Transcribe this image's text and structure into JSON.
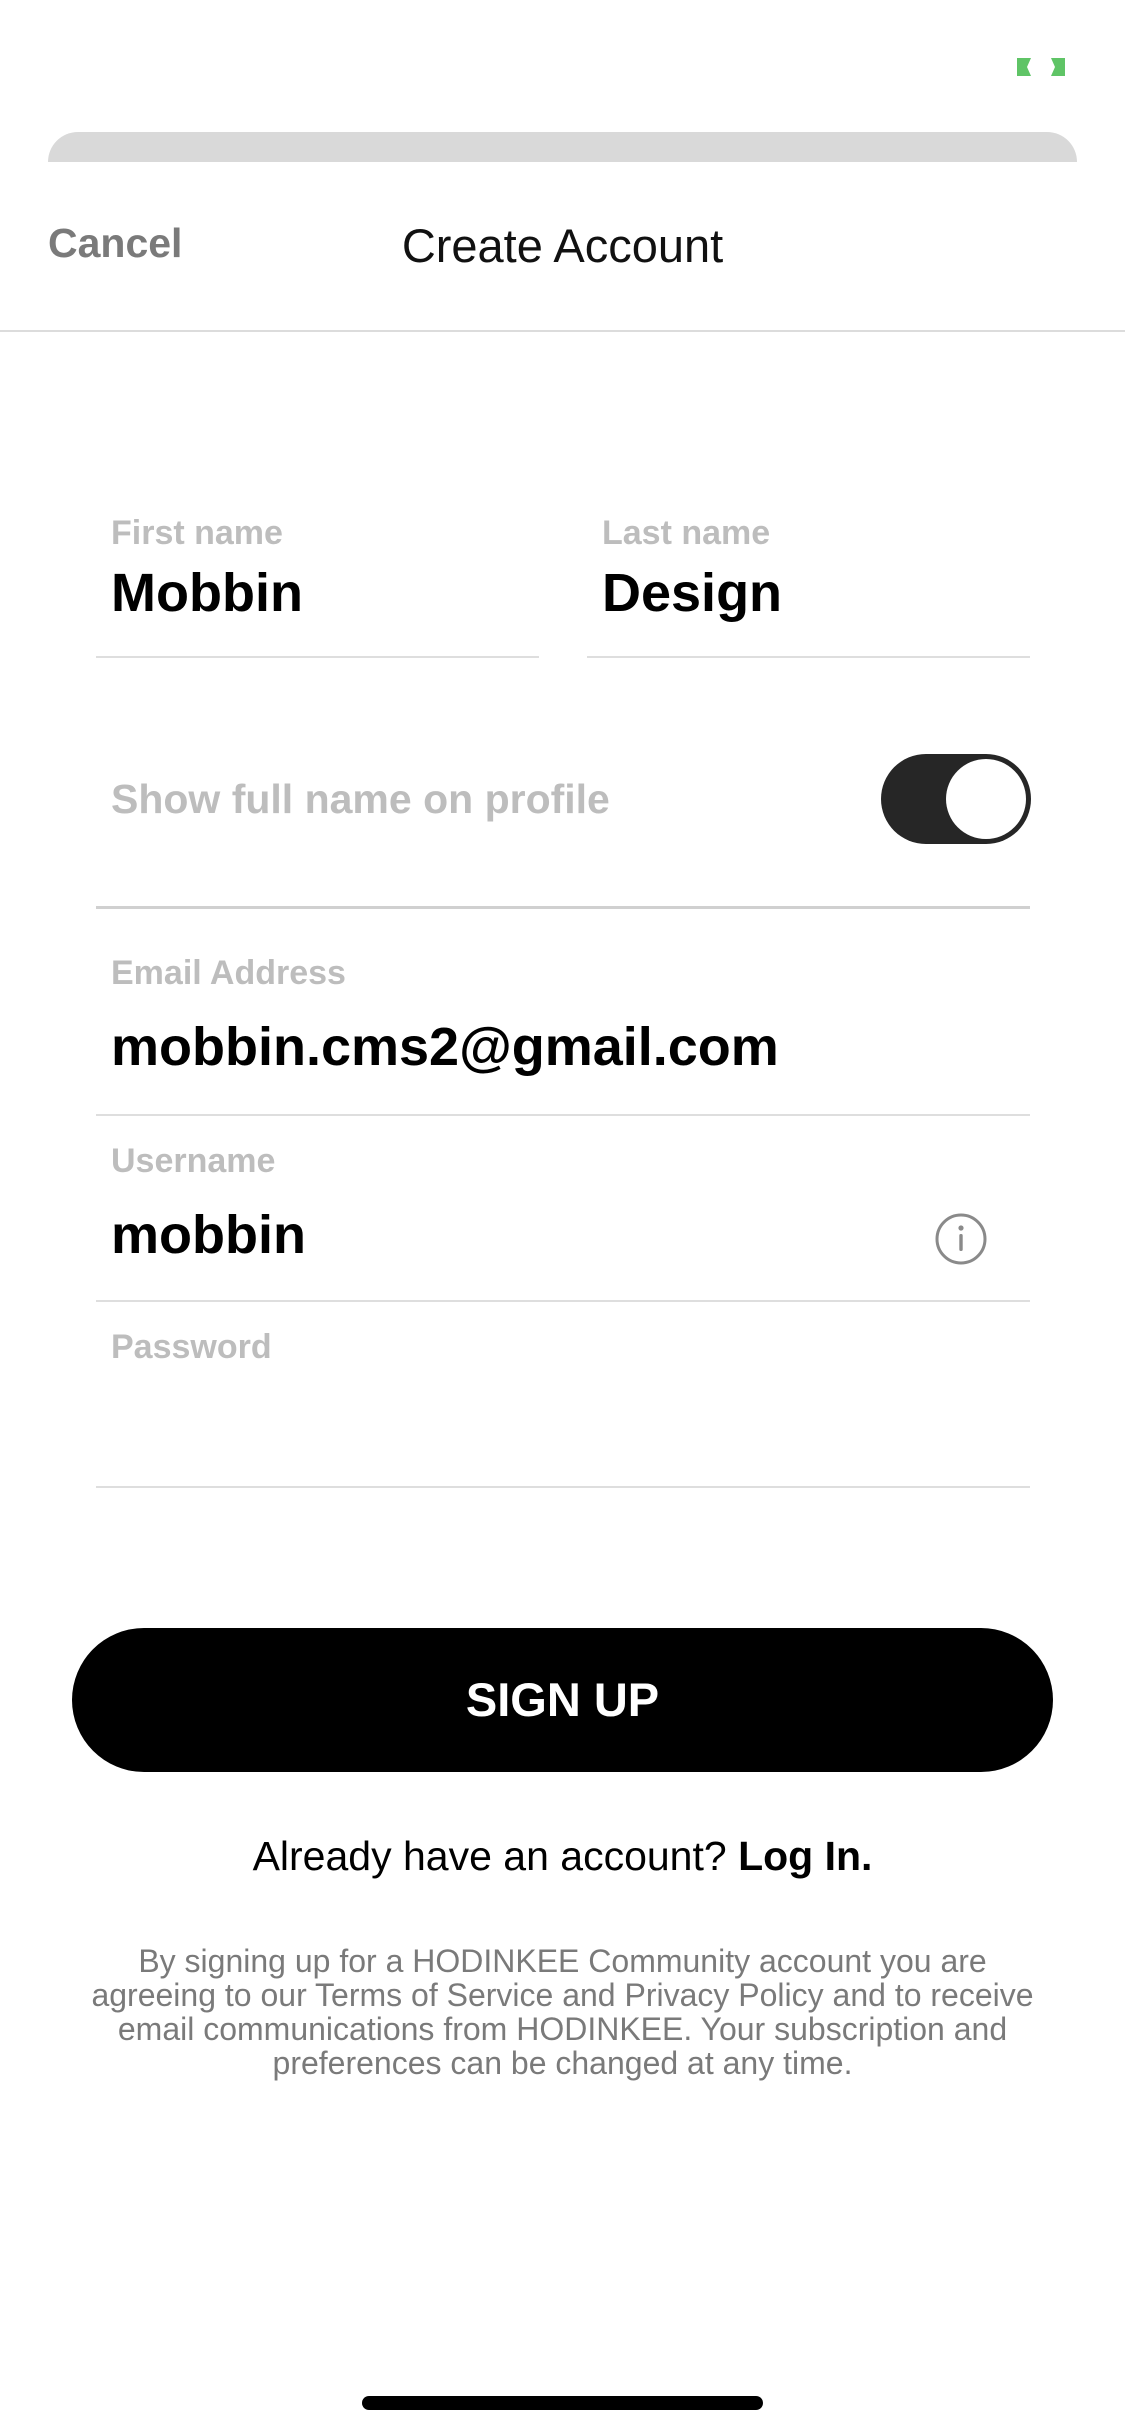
{
  "colors": {
    "accent_text": "#000000",
    "muted_label": "#bdbdbd",
    "cancel_text": "#7a7a7a",
    "signup_button_bg": "#000000",
    "toggle_on_bg": "#262626",
    "status_indicator": "#5fc466"
  },
  "nav": {
    "cancel_label": "Cancel",
    "title": "Create Account"
  },
  "form": {
    "first_name": {
      "label": "First name",
      "value": "Mobbin"
    },
    "last_name": {
      "label": "Last name",
      "value": "Design"
    },
    "show_full_name": {
      "label": "Show full name on profile",
      "enabled": true
    },
    "email": {
      "label": "Email Address",
      "value": "mobbin.cms2@gmail.com"
    },
    "username": {
      "label": "Username",
      "value": "mobbin",
      "info_icon": "info-circle-icon"
    },
    "password": {
      "label": "Password",
      "value": ""
    }
  },
  "signup_button_label": "SIGN UP",
  "login_prompt": {
    "text": "Already have an account?",
    "link": "Log In."
  },
  "legal_text": "By signing up for a HODINKEE Community account you are agreeing to our Terms of Service and Privacy Policy and to receive email communications from HODINKEE. Your subscription and preferences can be changed at any time."
}
